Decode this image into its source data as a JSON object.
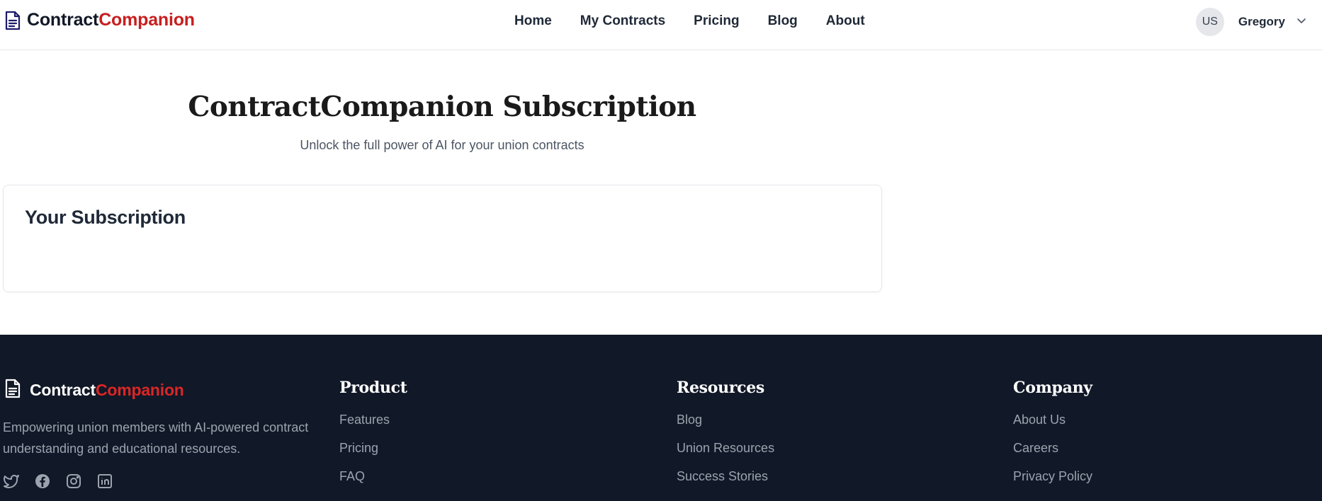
{
  "header": {
    "logo": {
      "part1": "Contract",
      "part2": "Companion",
      "icon": "document-icon"
    },
    "nav": [
      "Home",
      "My Contracts",
      "Pricing",
      "Blog",
      "About"
    ],
    "user": {
      "initials": "US",
      "name": "Gregory",
      "menu_icon": "chevron-down-icon"
    }
  },
  "main": {
    "title": "ContractCompanion Subscription",
    "subtitle": "Unlock the full power of AI for your union contracts",
    "card": {
      "title": "Your Subscription"
    }
  },
  "footer": {
    "logo": {
      "part1": "Contract",
      "part2": "Companion",
      "icon": "document-icon"
    },
    "description": "Empowering union members with AI-powered contract understanding and educational resources.",
    "socials": [
      "twitter-icon",
      "facebook-icon",
      "instagram-icon",
      "linkedin-icon"
    ],
    "columns": [
      {
        "heading": "Product",
        "links": [
          "Features",
          "Pricing",
          "FAQ"
        ]
      },
      {
        "heading": "Resources",
        "links": [
          "Blog",
          "Union Resources",
          "Success Stories"
        ]
      },
      {
        "heading": "Company",
        "links": [
          "About Us",
          "Careers",
          "Privacy Policy"
        ]
      }
    ]
  },
  "colors": {
    "brand_red": "#c81e1e",
    "footer_bg": "#111827",
    "logo_icon": "#1e1b6b"
  }
}
